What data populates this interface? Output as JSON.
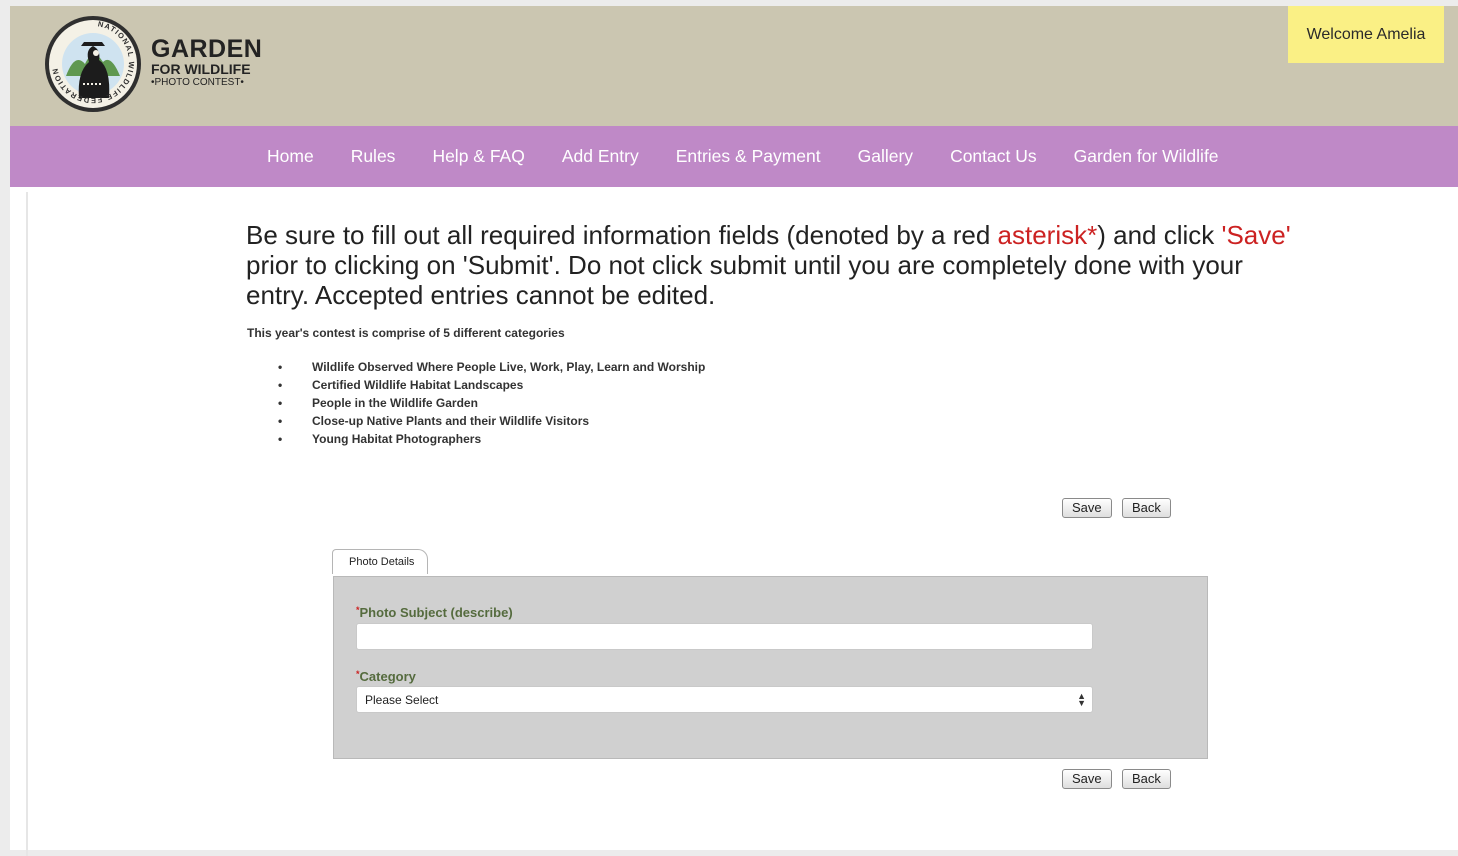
{
  "header": {
    "brand_line1": "GARDEN",
    "brand_line2": "FOR WILDLIFE",
    "brand_line3": "•PHOTO CONTEST•",
    "logo_ring_text": "NATIONAL WILDLIFE FEDERATION",
    "welcome": "Welcome Amelia"
  },
  "nav": {
    "items": [
      "Home",
      "Rules",
      "Help & FAQ",
      "Add Entry",
      "Entries & Payment",
      "Gallery",
      "Contact Us",
      "Garden for Wildlife"
    ]
  },
  "instructions": {
    "p1": "Be sure to fill out all required information fields (denoted by a red ",
    "asterisk": "asterisk*",
    "p2": ") and click ",
    "save_word": "'Save'",
    "p3": " prior to clicking on 'Submit'. Do not click submit until you are completely done with your entry. Accepted entries cannot be edited."
  },
  "intro": "This year's contest is comprise of 5 different categories",
  "categories": [
    "Wildlife Observed Where People Live, Work, Play, Learn and Worship",
    "Certified Wildlife Habitat Landscapes",
    "People in the Wildlife Garden",
    "Close-up Native Plants and their Wildlife Visitors",
    "Young Habitat Photographers"
  ],
  "buttons": {
    "save": "Save",
    "back": "Back"
  },
  "form": {
    "tab_label": "Photo Details",
    "required_mark": "*",
    "subject_label": "Photo Subject (describe)",
    "subject_value": "",
    "category_label": "Category",
    "category_selected": "Please Select"
  },
  "colors": {
    "header_bg": "#cbc6b1",
    "nav_bg": "#bf89c7",
    "welcome_bg": "#faf085",
    "required_red": "#cc2222",
    "label_green": "#556b3e",
    "panel_bg": "#d0d0d0"
  },
  "icons": {
    "logo": "bear-emblem-icon",
    "select_arrows": "updown-arrows-icon",
    "bullet": "bullet-icon"
  }
}
